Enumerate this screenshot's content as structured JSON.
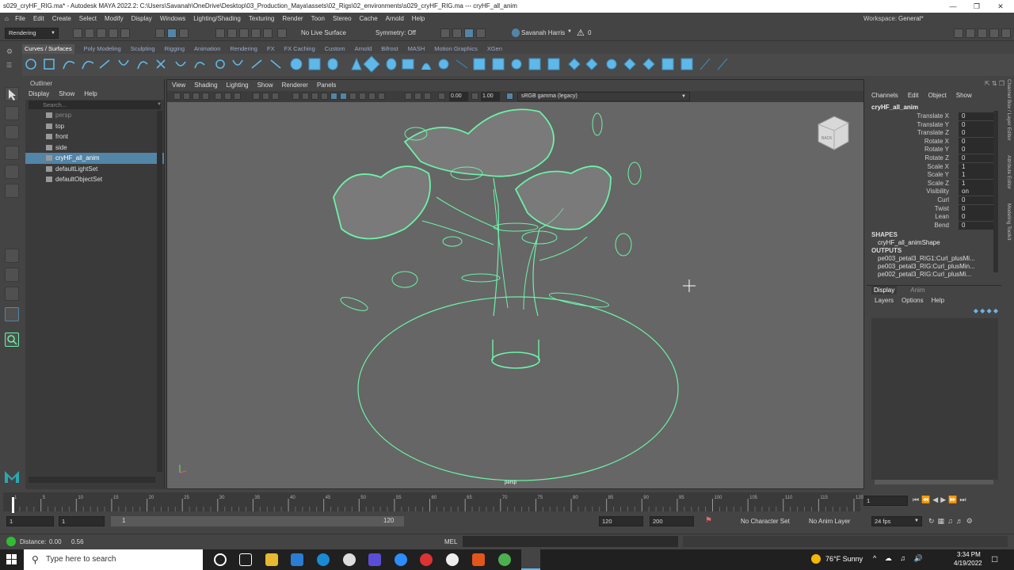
{
  "titlebar": {
    "title": "s029_cryHF_RIG.ma* - Autodesk MAYA 2022.2: C:\\Users\\Savanah\\OneDrive\\Desktop\\03_Production_Maya\\assets\\02_Rigs\\02_environments\\s029_cryHF_RIG.ma  ---  cryHF_all_anim"
  },
  "menubar": {
    "items": [
      "File",
      "Edit",
      "Create",
      "Select",
      "Modify",
      "Display",
      "Windows",
      "Lighting/Shading",
      "Texturing",
      "Render",
      "Toon",
      "Stereo",
      "Cache",
      "Arnold",
      "Help"
    ],
    "workspace_label": "Workspace:",
    "workspace_value": "General*"
  },
  "statusline": {
    "menuset": "Rendering",
    "live_surface": "No Live Surface",
    "symmetry": "Symmetry: Off",
    "user": "Savanah Harris",
    "warnings": "0"
  },
  "shelf": {
    "tabs": [
      "Curves / Surfaces",
      "Poly Modeling",
      "Sculpting",
      "Rigging",
      "Animation",
      "Rendering",
      "FX",
      "FX Caching",
      "Custom",
      "Arnold",
      "Bifrost",
      "MASH",
      "Motion Graphics",
      "XGen"
    ],
    "active": "Curves / Surfaces"
  },
  "outliner": {
    "title": "Outliner",
    "menu": [
      "Display",
      "Show",
      "Help"
    ],
    "search_placeholder": "Search...",
    "items": [
      {
        "label": "persp",
        "dim": true
      },
      {
        "label": "top"
      },
      {
        "label": "front"
      },
      {
        "label": "side"
      },
      {
        "label": "cryHF_all_anim",
        "selected": true
      },
      {
        "label": "defaultLightSet"
      },
      {
        "label": "defaultObjectSet"
      }
    ]
  },
  "viewport": {
    "menu": [
      "View",
      "Shading",
      "Lighting",
      "Show",
      "Renderer",
      "Panels"
    ],
    "exposure": "0.00",
    "gamma": "1.00",
    "color_space": "sRGB gamma (legacy)",
    "camera_label": "persp",
    "viewcube_label": "BACK"
  },
  "channelbox": {
    "menu": [
      "Channels",
      "Edit",
      "Object",
      "Show"
    ],
    "object": "cryHF_all_anim",
    "channels": [
      {
        "name": "Translate X",
        "value": "0"
      },
      {
        "name": "Translate Y",
        "value": "0"
      },
      {
        "name": "Translate Z",
        "value": "0"
      },
      {
        "name": "Rotate X",
        "value": "0"
      },
      {
        "name": "Rotate Y",
        "value": "0"
      },
      {
        "name": "Rotate Z",
        "value": "0"
      },
      {
        "name": "Scale X",
        "value": "1"
      },
      {
        "name": "Scale Y",
        "value": "1"
      },
      {
        "name": "Scale Z",
        "value": "1"
      },
      {
        "name": "Visibility",
        "value": "on"
      },
      {
        "name": "Curl",
        "value": "0"
      },
      {
        "name": "Twist",
        "value": "0"
      },
      {
        "name": "Lean",
        "value": "0"
      },
      {
        "name": "Bend",
        "value": "0"
      }
    ],
    "shapes_header": "SHAPES",
    "shape": "cryHF_all_animShape",
    "outputs_header": "OUTPUTS",
    "outputs": [
      "pe003_petal3_RIG1:Curl_plusMi...",
      "pe003_petal3_RIG:Curl_plusMin...",
      "pe002_petal3_RIG:Curl_plusMi..."
    ]
  },
  "layers": {
    "tabs": [
      "Display",
      "Anim"
    ],
    "menu": [
      "Layers",
      "Options",
      "Help"
    ]
  },
  "sidetabs": [
    "Channel Box / Layer Editor",
    "Attribute Editor",
    "Modeling Toolkit"
  ],
  "timeline": {
    "ticks": [
      "1",
      "5",
      "10",
      "15",
      "20",
      "25",
      "30",
      "35",
      "40",
      "45",
      "50",
      "55",
      "60",
      "65",
      "70",
      "75",
      "80",
      "85",
      "90",
      "95",
      "100",
      "105",
      "110",
      "115",
      "120"
    ],
    "current_frame": "1"
  },
  "range": {
    "start": "1",
    "playback_start": "1",
    "slider_start": "1",
    "slider_end": "120",
    "playback_end": "120",
    "end": "200",
    "character_set": "No Character Set",
    "anim_layer": "No Anim Layer",
    "fps": "24 fps"
  },
  "cmdline": {
    "distance_label": "Distance:",
    "distance_value": "0.00",
    "distance_value2": "0.56",
    "lang": "MEL"
  },
  "taskbar": {
    "search_placeholder": "Type here to search",
    "weather": "76°F  Sunny",
    "time": "3:34 PM",
    "date": "4/19/2022"
  },
  "colors": {
    "wire": "#6cf2a8",
    "selection": "#5285a6",
    "viewport_bg": "#666666"
  }
}
